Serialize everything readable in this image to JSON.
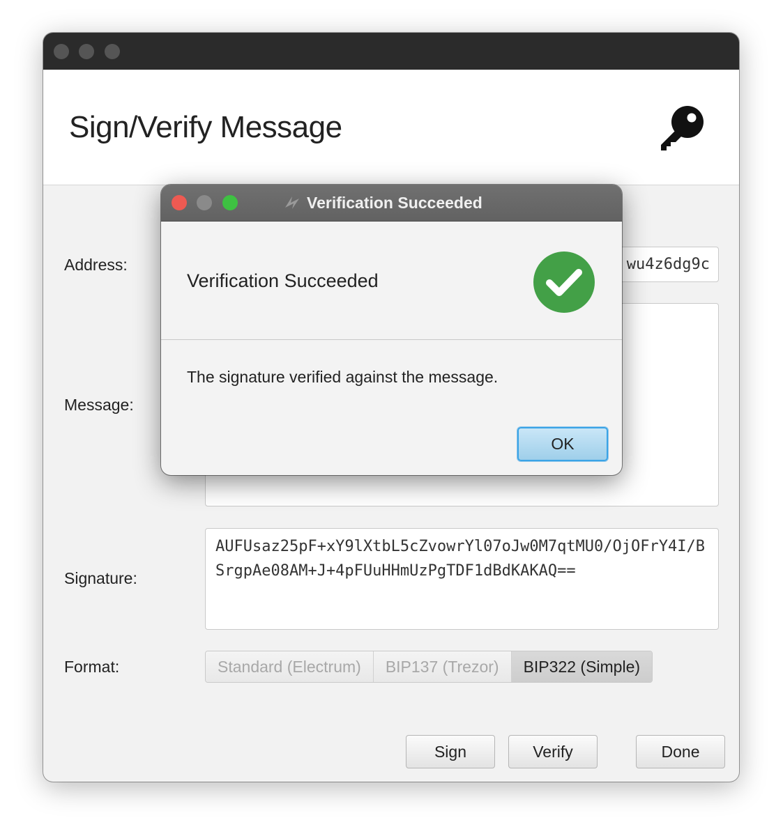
{
  "main_window": {
    "title": "Sign/Verify Message",
    "labels": {
      "address": "Address:",
      "message": "Message:",
      "signature": "Signature:",
      "format": "Format:"
    },
    "address_value": "wu4z6dg9c",
    "message_value": "",
    "signature_value": "AUFUsaz25pF+xY9lXtbL5cZvowrYl07oJw0M7qtMU0/OjOFrY4I/BSrgpAe08AM+J+4pFUuHHmUzPgTDF1dBdKAKAQ==",
    "format_options": [
      "Standard (Electrum)",
      "BIP137 (Trezor)",
      "BIP322 (Simple)"
    ],
    "format_selected": "BIP322 (Simple)",
    "buttons": {
      "sign": "Sign",
      "verify": "Verify",
      "done": "Done"
    },
    "icons": {
      "header": "key-icon"
    }
  },
  "dialog": {
    "title": "Verification Succeeded",
    "heading": "Verification Succeeded",
    "message": "The signature verified against the message.",
    "ok_label": "OK",
    "icons": {
      "status": "check-circle-icon",
      "app": "app-icon"
    }
  },
  "colors": {
    "success_green": "#43a047",
    "close_red": "#ee5a52",
    "zoom_green": "#3ec142",
    "focus_blue": "#3aa3e6"
  }
}
